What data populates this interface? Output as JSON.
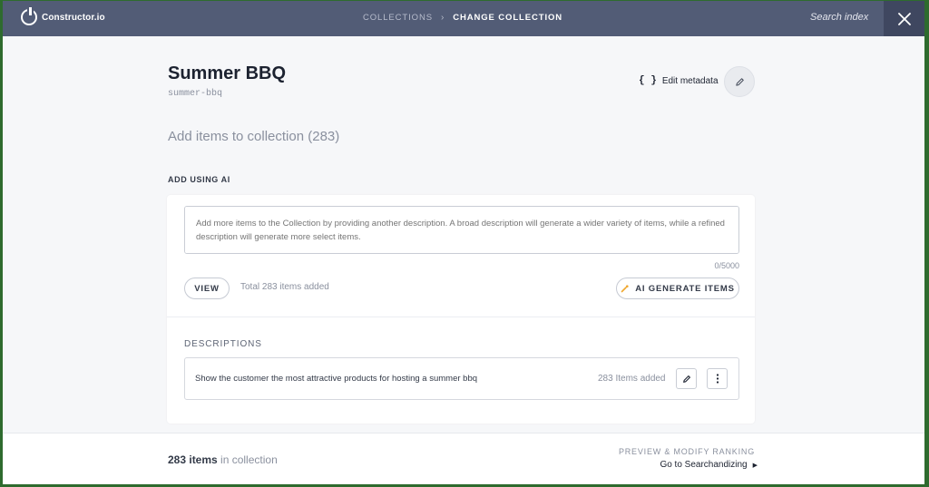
{
  "header": {
    "brand": "Constructor.io",
    "breadcrumb": {
      "parent": "COLLECTIONS",
      "separator": "›",
      "current": "CHANGE COLLECTION"
    },
    "search_label": "Search index",
    "close_icon": "close-icon"
  },
  "collection": {
    "title": "Summer BBQ",
    "slug": "summer-bbq",
    "edit_metadata_label": "Edit metadata",
    "edit_metadata_icon": "{ }"
  },
  "add_items": {
    "heading": "Add items to collection (283)",
    "section_label": "ADD USING AI",
    "input_placeholder": "Add more items to the Collection by providing another description. A broad description will generate a wider variety of items, while a refined description will generate more select items.",
    "counter": "0/5000",
    "view_label": "VIEW",
    "total_text": "Total 283 items added",
    "generate_label": "AI GENERATE ITEMS"
  },
  "descriptions": {
    "label": "DESCRIPTIONS",
    "items": [
      {
        "text": "Show the customer the most attractive products for hosting a summer bbq",
        "count": "283 Items added"
      }
    ]
  },
  "footer": {
    "count_number": "283 items",
    "count_suffix": " in collection",
    "preview_label": "PREVIEW & MODIFY RANKING",
    "goto_label": "Go to Searchandizing"
  },
  "colors": {
    "topbar": "#525c76",
    "close_bg": "#3f4760",
    "accent_wand": "#f0a830",
    "frame_border": "#2e6b2e"
  }
}
